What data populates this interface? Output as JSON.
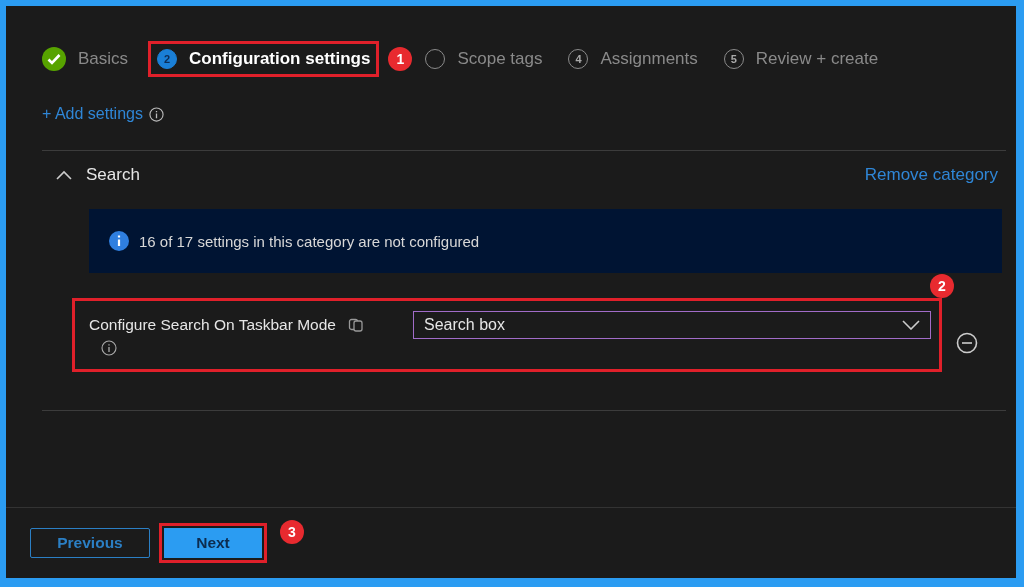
{
  "steps": [
    {
      "kind": "complete",
      "label": "Basics",
      "selected": false
    },
    {
      "kind": "numbered",
      "number": "2",
      "label": "Configuration settings",
      "selected": true,
      "callout": "1"
    },
    {
      "kind": "numbered",
      "label": "Scope tags",
      "selected": false
    },
    {
      "kind": "numbered",
      "number": "4",
      "label": "Assignments",
      "selected": false
    },
    {
      "kind": "numbered",
      "number": "5",
      "label": "Review + create",
      "selected": false
    }
  ],
  "add_settings": {
    "label": "+ Add settings"
  },
  "category": {
    "title": "Search",
    "expanded": true,
    "remove_link": "Remove category",
    "info_banner": "16 of 17 settings in this category are not configured",
    "settings": [
      {
        "label": "Configure Search On Taskbar Mode",
        "value": "Search box",
        "callout": "2"
      }
    ]
  },
  "footer": {
    "buttons": [
      {
        "label": "Previous",
        "kind": "secondary"
      },
      {
        "label": "Next",
        "kind": "primary",
        "callout": "3"
      }
    ]
  }
}
